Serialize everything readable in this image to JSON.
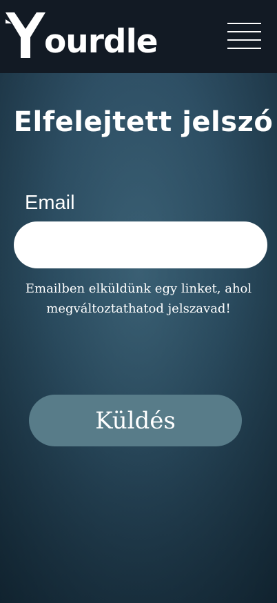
{
  "header": {
    "logo_text": "ourdle",
    "menu_icon": "hamburger-menu-icon",
    "background_color": "#121a24"
  },
  "form": {
    "title": "Elfelejtett jelszó",
    "email_label": "Email",
    "email_value": "",
    "email_placeholder": "",
    "hint": "Emailben elküldünk egy linket, ahol megváltoztathatod jelszavad!",
    "submit_label": "Küldés",
    "submit_color": "#587c89"
  }
}
